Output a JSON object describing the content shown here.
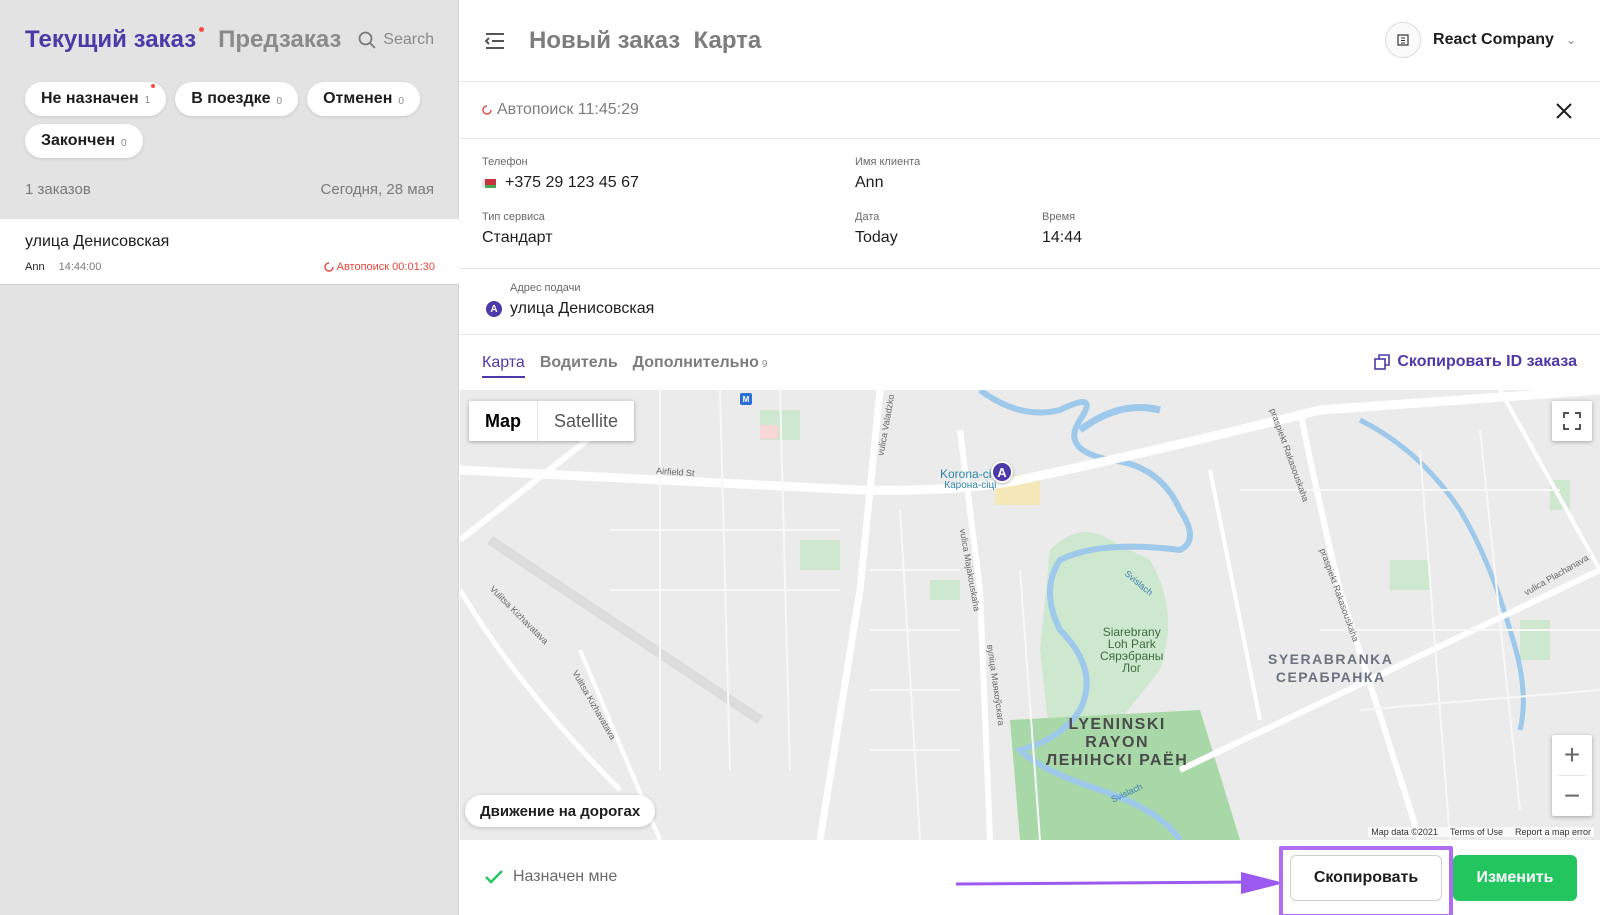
{
  "left": {
    "tab_current": "Текущий заказ",
    "tab_preorder": "Предзаказ",
    "search_label": "Search",
    "chips": [
      {
        "label": "Не назначен",
        "count": "1"
      },
      {
        "label": "В поездке",
        "count": "0"
      },
      {
        "label": "Отменен",
        "count": "0"
      },
      {
        "label": "Закончен",
        "count": "0"
      }
    ],
    "orders_count": "1 заказов",
    "date_label": "Сегодня, 28 мая",
    "order": {
      "address": "улица Денисовская",
      "client": "Ann",
      "time": "14:44:00",
      "status": "Автопоиск 00:01:30"
    }
  },
  "header": {
    "title": "Новый заказ  Карта",
    "company": "React Company"
  },
  "autosearch": {
    "label": "Автопоиск 11:45:29"
  },
  "info": {
    "phone_label": "Телефон",
    "phone_value": "+375 29 123 45 67",
    "client_label": "Имя клиента",
    "client_value": "Ann",
    "service_label": "Тип сервиса",
    "service_value": "Стандарт",
    "date_label": "Дата",
    "date_value": "Today",
    "time_label": "Время",
    "time_value": "14:44"
  },
  "pickup": {
    "label": "Адрес подачи",
    "marker": "A",
    "value": "улица Денисовская"
  },
  "tabs": [
    {
      "label": "Карта"
    },
    {
      "label": "Водитель"
    },
    {
      "label": "Дополнительно",
      "count": "9"
    }
  ],
  "copy_id_label": "Скопировать ID заказа",
  "map": {
    "type_map": "Map",
    "type_satellite": "Satellite",
    "traffic": "Движение на дорогах",
    "data_credit": "Map data ©2021",
    "terms": "Terms of Use",
    "report": "Report a map error",
    "marker": "A",
    "metro": "M",
    "labels": {
      "airfield": "Airfield St",
      "valadzka": "vulica Valadzko",
      "majakouskaha": "vulica Majakouskaha",
      "majakouskaha_ru": "вуліца Маякоўскага",
      "kizhavatava1": "Vulitsa Kizhavatava",
      "kizhavatava2": "Vulitsa Kizhavatava",
      "svislach1": "Svislach",
      "svislach2": "Svislach",
      "rakasouskaha1": "praspiekt Rakasouskaha",
      "rakasouskaha2": "praspiekt Rakasouskaha",
      "plachanava": "vulica Plachanava",
      "korona": "Korona-city",
      "korona_ru": "Карона-сіці",
      "park": "Siarebrany\nLoh Park\nСярэбраны\nЛог",
      "syerabranka": "SYERABRANKA\nСЕРАБРАНКА",
      "lyeninski": "LYENINSKI\nRAYON\nЛЕНІНСКІ РАЁН"
    }
  },
  "footer": {
    "assigned": "Назначен мне",
    "copy_btn": "Скопировать",
    "edit_btn": "Изменить"
  },
  "colors": {
    "accent": "#4b3aa8",
    "green": "#22c55e",
    "highlight": "#b06cf3",
    "alert": "#e8463c"
  }
}
